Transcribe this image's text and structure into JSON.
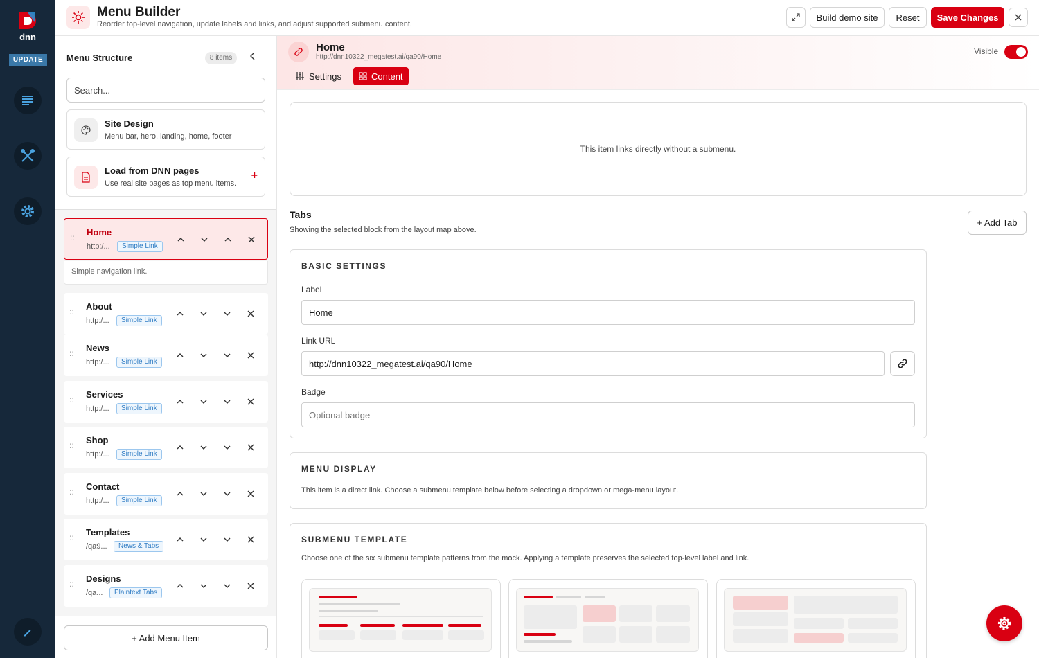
{
  "header": {
    "title": "Menu Builder",
    "subtitle": "Reorder top-level navigation, update labels and links, and adjust supported submenu content.",
    "build_demo_label": "Build demo site",
    "reset_label": "Reset",
    "save_label": "Save Changes"
  },
  "rail": {
    "logo_text": "dnn",
    "update_label": "UPDATE",
    "icons": [
      "content-icon",
      "tools-icon",
      "settings-icon",
      "edit-icon"
    ]
  },
  "sidebar": {
    "title": "Menu Structure",
    "count": "8 items",
    "search_placeholder": "Search...",
    "site_design": {
      "title": "Site Design",
      "subtitle": "Menu bar, hero, landing, home, footer"
    },
    "load_dnn": {
      "title": "Load from DNN pages",
      "subtitle": "Use real site pages as top menu items.",
      "plus": "+"
    },
    "items": [
      {
        "label": "Home",
        "url": "http:/...",
        "tag": "Simple Link",
        "selected": true
      },
      {
        "label": "About",
        "url": "http:/...",
        "tag": "Simple Link"
      },
      {
        "label": "News",
        "url": "http:/...",
        "tag": "Simple Link"
      },
      {
        "label": "Services",
        "url": "http:/...",
        "tag": "Simple Link"
      },
      {
        "label": "Shop",
        "url": "http:/...",
        "tag": "Simple Link"
      },
      {
        "label": "Contact",
        "url": "http:/...",
        "tag": "Simple Link"
      },
      {
        "label": "Templates",
        "url": "/qa9...",
        "tag": "News & Tabs"
      },
      {
        "label": "Designs",
        "url": "/qa...",
        "tag": "Plaintext Tabs"
      }
    ],
    "selected_desc": "Simple navigation link.",
    "add_item_label": "+ Add Menu Item"
  },
  "detail": {
    "title": "Home",
    "url": "http://dnn10322_megatest.ai/qa90/Home",
    "visible_label": "Visible",
    "visible": true,
    "tabs": [
      {
        "label": "Settings"
      },
      {
        "label": "Content",
        "active": true
      }
    ],
    "no_submenu": "This item links directly without a submenu.",
    "tabs_section": {
      "title": "Tabs",
      "subtitle": "Showing the selected block from the layout map above.",
      "add_tab": "+ Add Tab"
    },
    "basic": {
      "heading": "BASIC SETTINGS",
      "label_label": "Label",
      "label_value": "Home",
      "url_label": "Link URL",
      "url_value": "http://dnn10322_megatest.ai/qa90/Home",
      "badge_label": "Badge",
      "badge_placeholder": "Optional badge"
    },
    "menu_display": {
      "heading": "MENU DISPLAY",
      "text": "This item is a direct link. Choose a submenu template below before selecting a dropdown or mega-menu layout."
    },
    "submenu_template": {
      "heading": "SUBMENU TEMPLATE",
      "text": "Choose one of the six submenu template patterns from the mock. Applying a template preserves the selected top-level label and link."
    }
  },
  "colors": {
    "accent": "#d90012",
    "rail": "#16283a",
    "tag_blue": "#2f7cc4"
  }
}
